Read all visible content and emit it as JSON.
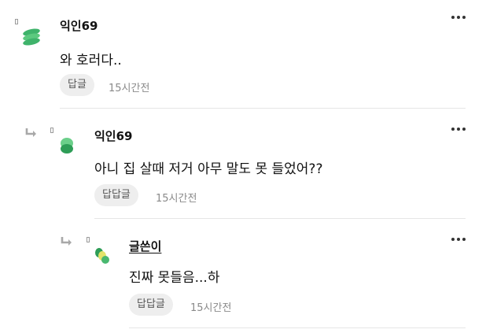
{
  "comments": [
    {
      "author": "익인69",
      "text": "와 호러다..",
      "reply_label": "답글",
      "time": "15시간전",
      "more_icon": "more-dots-icon",
      "avatar_icon": "green-stack-avatar"
    },
    {
      "author": "익인69",
      "text": "아니 집 살때 저거 아무 말도 못 들었어??",
      "reply_label": "답답글",
      "time": "15시간전",
      "more_icon": "more-dots-icon",
      "avatar_icon": "green-leaf-avatar",
      "reply_icon": "reply-arrow-icon"
    },
    {
      "author": "글쓴이",
      "text": "진짜 못들음...하",
      "reply_label": "답답글",
      "time": "15시간전",
      "more_icon": "more-dots-icon",
      "avatar_icon": "green-yellow-avatar",
      "reply_icon": "reply-arrow-icon"
    }
  ]
}
